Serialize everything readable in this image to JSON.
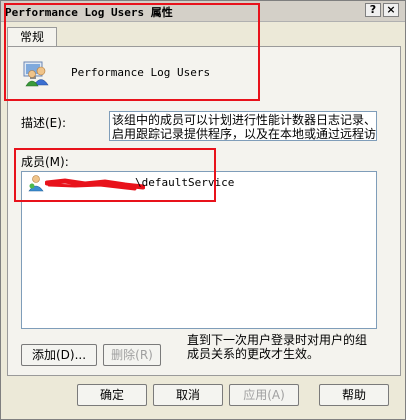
{
  "window": {
    "title": "Performance Log Users 属性",
    "help_glyph": "?",
    "close_glyph": "×"
  },
  "tabs": [
    {
      "label": "常规"
    }
  ],
  "general": {
    "group_name": "Performance Log Users",
    "description_label": "描述(E):",
    "description_line1": "该组中的成员可以计划进行性能计数器日志记录、",
    "description_line2": "启用跟踪记录提供程序，以及在本地或通过远程访",
    "members_label": "成员(M):",
    "members": [
      {
        "name": "\\defaultService",
        "redacted": true
      }
    ],
    "add_button": "添加(D)...",
    "remove_button": "删除(R)",
    "note_line1": "直到下一次用户登录时对用户的组",
    "note_line2": "成员关系的更改才生效。"
  },
  "footer": {
    "ok": "确定",
    "cancel": "取消",
    "apply": "应用(A)",
    "help": "帮助"
  },
  "colors": {
    "dialog_bg": "#ece9d8",
    "panel_bg": "#f4f3ee",
    "annotation_red": "#e8121b",
    "redaction_red": "#e8121b",
    "input_border": "#7f9db9"
  },
  "icons": {
    "group": "group-users-icon",
    "member": "user-icon",
    "help": "help-icon",
    "close": "close-icon"
  }
}
